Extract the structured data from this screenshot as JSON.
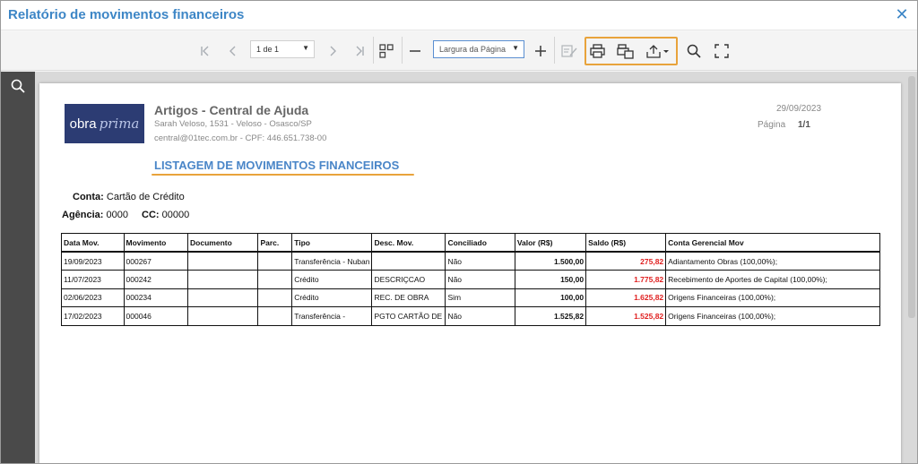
{
  "window": {
    "title": "Relatório de movimentos financeiros",
    "close_icon": "close-icon"
  },
  "toolbar": {
    "page_select_value": "1 de 1",
    "zoom_select_value": "Largura da Página",
    "icons": [
      "first-page-icon",
      "prev-page-icon",
      "next-page-icon",
      "last-page-icon",
      "multi-page-icon",
      "zoom-out-icon",
      "zoom-in-icon",
      "edit-form-icon",
      "print-icon",
      "print-page-icon",
      "export-icon",
      "search-icon",
      "fullscreen-icon"
    ],
    "highlight_color": "#e8a33b"
  },
  "report": {
    "company": "Artigos - Central de Ajuda",
    "address": "Sarah Veloso, 1531 - Veloso - Osasco/SP",
    "contact": "central@01tec.com.br - CPF: 446.651.738-00",
    "logo_text_1": "obra",
    "logo_text_2": "prima",
    "date": "29/09/2023",
    "page_label": "Página",
    "page_value": "1/1",
    "title": "LISTAGEM DE MOVIMENTOS FINANCEIROS",
    "conta_label": "Conta:",
    "conta_value": "Cartão de Crédito",
    "agencia_label": "Agência:",
    "agencia_value": "0000",
    "cc_label": "CC:",
    "cc_value": "00000",
    "columns": [
      "Data Mov.",
      "Movimento",
      "Documento",
      "Parc.",
      "Tipo",
      "Desc. Mov.",
      "Conciliado",
      "Valor (R$)",
      "Saldo (R$)",
      "Conta Gerencial Mov"
    ],
    "rows": [
      {
        "data": "19/09/2023",
        "movimento": "000267",
        "documento": "",
        "parc": "",
        "tipo": "Transferência - Nuban",
        "desc": "",
        "conciliado": "Não",
        "valor": "1.500,00",
        "saldo": "275,82",
        "conta": "Adiantamento Obras (100,00%);"
      },
      {
        "data": "11/07/2023",
        "movimento": "000242",
        "documento": "",
        "parc": "",
        "tipo": "Crédito",
        "desc": "DESCRIÇCAO",
        "conciliado": "Não",
        "valor": "150,00",
        "saldo": "1.775,82",
        "conta": "Recebimento de Aportes de Capital (100,00%);"
      },
      {
        "data": "02/06/2023",
        "movimento": "000234",
        "documento": "",
        "parc": "",
        "tipo": "Crédito",
        "desc": "REC. DE OBRA",
        "conciliado": "Sim",
        "valor": "100,00",
        "saldo": "1.625,82",
        "conta": "Origens Financeiras (100,00%);"
      },
      {
        "data": "17/02/2023",
        "movimento": "000046",
        "documento": "",
        "parc": "",
        "tipo": "Transferência -",
        "desc": "PGTO CARTÃO DE",
        "conciliado": "Não",
        "valor": "1.525,82",
        "saldo": "1.525,82",
        "conta": "Origens Financeiras (100,00%);"
      }
    ]
  },
  "colors": {
    "title_blue": "#3d86c6",
    "saldo_red": "#e02020",
    "sidebar": "#4a4a4a",
    "logo_bg": "#2c3c73"
  }
}
